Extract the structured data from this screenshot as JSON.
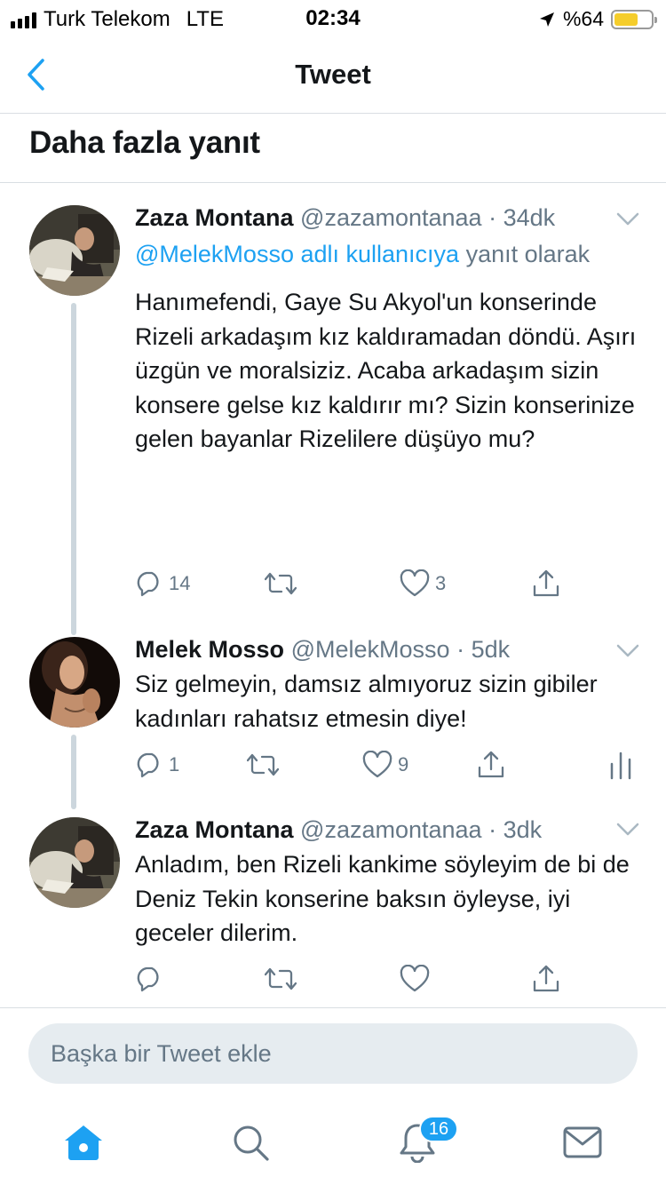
{
  "status_bar": {
    "carrier": "Turk Telekom",
    "network": "LTE",
    "time": "02:34",
    "battery_text": "%64",
    "battery_level": 0.64,
    "battery_color": "#f5cd2b"
  },
  "nav": {
    "title": "Tweet",
    "back_icon": "chevron-left-icon"
  },
  "section": {
    "title": "Daha fazla yanıt"
  },
  "colors": {
    "accent": "#1da1f2",
    "muted": "#657786",
    "thread_line": "#ccd6dd"
  },
  "tweets": [
    {
      "name": "Zaza Montana",
      "handle": "@zazamontanaa",
      "separator": "·",
      "time": "34dk",
      "reply_to_link": "@MelekMosso adlı kullanıcıya",
      "reply_to_suffix": " yanıt olarak",
      "text": "Hanımefendi, Gaye Su Akyol'un konserinde Rizeli arkadaşım kız kaldıramadan döndü. Aşırı üzgün ve moralsiziz. Acaba arkadaşım sizin konsere gelse kız kaldırır mı? Sizin konserinize gelen bayanlar Rizelilere düşüyo mu?",
      "replies": "14",
      "retweets": "",
      "likes": "3"
    },
    {
      "name": "Melek Mosso",
      "handle": "@MelekMosso",
      "separator": "·",
      "time": "5dk",
      "text": "Siz gelmeyin, damsız almıyoruz sizin gibiler kadınları rahatsız etmesin diye!",
      "replies": "1",
      "retweets": "",
      "likes": "9"
    },
    {
      "name": "Zaza Montana",
      "handle": "@zazamontanaa",
      "separator": "·",
      "time": "3dk",
      "text": "Anladım, ben Rizeli kankime söyleyim de bi de Deniz Tekin konserine baksın öyleyse, iyi geceler dilerim.",
      "replies": "",
      "retweets": "",
      "likes": ""
    }
  ],
  "compose": {
    "placeholder": "Başka bir Tweet ekle"
  },
  "tab_bar": {
    "notifications_badge": "16"
  }
}
